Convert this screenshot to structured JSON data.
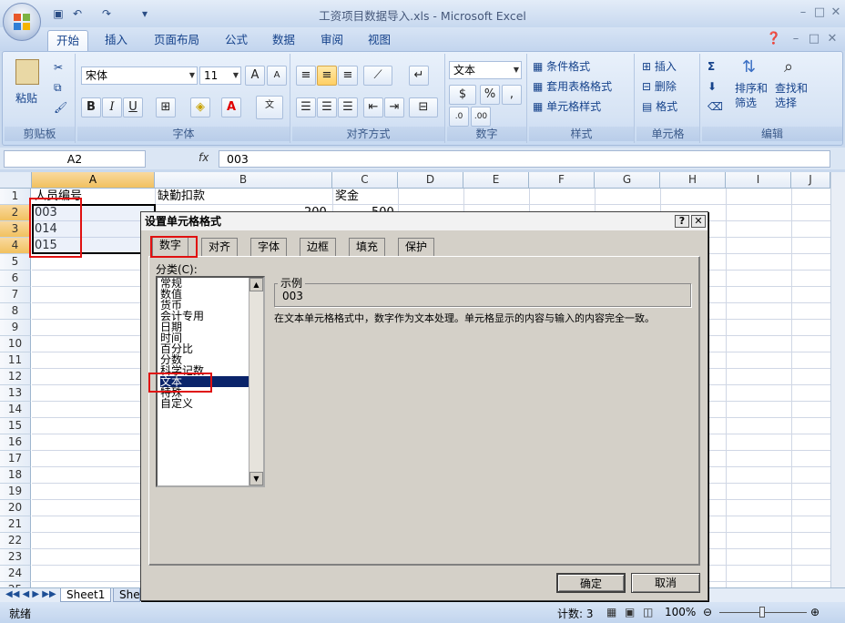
{
  "window": {
    "title": "工资项目数据导入.xls - Microsoft Excel"
  },
  "ribbon_tabs": [
    "开始",
    "插入",
    "页面布局",
    "公式",
    "数据",
    "审阅",
    "视图"
  ],
  "ribbon": {
    "paste": "粘贴",
    "groups": {
      "clipboard": "剪贴板",
      "font": "字体",
      "align": "对齐方式",
      "number": "数字",
      "styles": "样式",
      "cells": "单元格",
      "edit": "编辑"
    },
    "font_name": "宋体",
    "font_size": "11",
    "number_format": "文本",
    "bold": "B",
    "italic": "I",
    "underline": "U",
    "conditional_format": "条件格式",
    "table_format": "套用表格格式",
    "cell_style": "单元格样式",
    "insert": "插入",
    "delete": "删除",
    "format": "格式",
    "sort": "排序和",
    "sort2": "筛选",
    "find": "查找和",
    "find2": "选择",
    "percent": "%",
    "comma": ","
  },
  "formula_bar": {
    "name_box": "A2",
    "fx": "fx",
    "value": "003"
  },
  "columns": [
    "A",
    "B",
    "C",
    "D",
    "E",
    "F",
    "G",
    "H",
    "I",
    "J"
  ],
  "rows": [
    "1",
    "2",
    "3",
    "4",
    "5",
    "6",
    "7",
    "8",
    "9",
    "10",
    "11",
    "12",
    "13",
    "14",
    "15",
    "16",
    "17",
    "18",
    "19",
    "20",
    "21",
    "22",
    "23",
    "24",
    "25"
  ],
  "cells": {
    "A1": "人员编号",
    "B1": "缺勤扣款",
    "C1": "奖金",
    "A2": "003",
    "A3": "014",
    "A4": "015",
    "B2": "200",
    "C2": "500"
  },
  "sheet_tabs": [
    "Sheet1",
    "Shee"
  ],
  "status": {
    "ready": "就绪",
    "count": "计数: 3",
    "zoom": "100%"
  },
  "dialog": {
    "title": "设置单元格格式",
    "help": "?",
    "close": "✕",
    "tabs": [
      "数字",
      "对齐",
      "字体",
      "边框",
      "填充",
      "保护"
    ],
    "category_label": "分类(C):",
    "categories": [
      "常规",
      "数值",
      "货币",
      "会计专用",
      "日期",
      "时间",
      "百分比",
      "分数",
      "科学记数",
      "文本",
      "特殊",
      "自定义"
    ],
    "selected_category": "文本",
    "sample_label": "示例",
    "sample_value": "003",
    "description": "在文本单元格格式中，数字作为文本处理。单元格显示的内容与输入的内容完全一致。",
    "ok": "确定",
    "cancel": "取消"
  },
  "colors": {
    "ribbon": "#dbe8f7",
    "selection": "#0a246a",
    "highlight": "#e01010",
    "dialog": "#d4d0c8"
  }
}
